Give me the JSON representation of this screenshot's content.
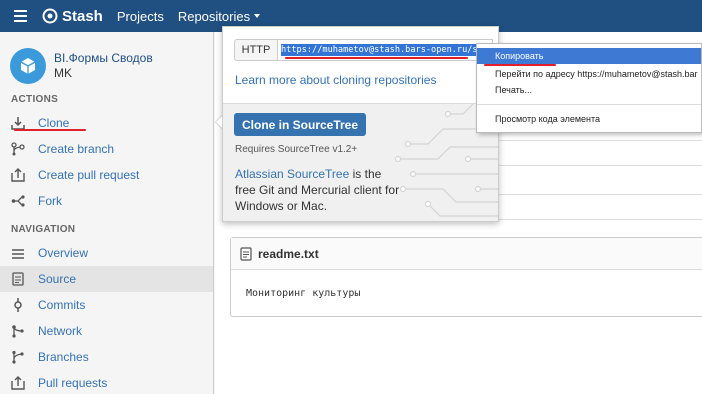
{
  "topbar": {
    "logo_text": "Stash",
    "nav": [
      {
        "label": "Projects"
      },
      {
        "label": "Repositories"
      }
    ]
  },
  "sidebar": {
    "repo_name": "BI.Формы Сводов",
    "project": "MK",
    "actions_title": "ACTIONS",
    "actions": [
      {
        "label": "Clone",
        "icon": "download-icon"
      },
      {
        "label": "Create branch",
        "icon": "branch-icon"
      },
      {
        "label": "Create pull request",
        "icon": "pull-request-icon"
      },
      {
        "label": "Fork",
        "icon": "fork-icon"
      }
    ],
    "navigation_title": "NAVIGATION",
    "navigation": [
      {
        "label": "Overview",
        "icon": "overview-icon"
      },
      {
        "label": "Source",
        "icon": "source-icon"
      },
      {
        "label": "Commits",
        "icon": "commit-icon"
      },
      {
        "label": "Network",
        "icon": "network-icon"
      },
      {
        "label": "Branches",
        "icon": "branches-icon"
      },
      {
        "label": "Pull requests",
        "icon": "pull-requests-icon"
      }
    ]
  },
  "clone": {
    "protocol": "HTTP",
    "url": "https://muhametov@stash.bars-open.ru/s",
    "learn_more": "Learn more about cloning repositories",
    "sourcetree_button": "Clone in SourceTree",
    "requires": "Requires SourceTree v1.2+",
    "desc_link": "Atlassian SourceTree",
    "desc_text": " is the free Git and Mercurial client for Windows or Mac."
  },
  "context_menu": {
    "items": [
      {
        "label": "Копировать",
        "highlighted": true
      },
      {
        "label": "Перейти по адресу https://muhametov@stash.bar"
      },
      {
        "label": "Печать..."
      },
      {
        "label": "Просмотр кода элемента"
      }
    ]
  },
  "readme": {
    "filename": "readme.txt",
    "content": "Мониторинг культуры"
  },
  "colors": {
    "topbar": "#205081",
    "link": "#3572b0",
    "annotation": "#e0202a",
    "menu_highlight": "#3e7ad3"
  }
}
